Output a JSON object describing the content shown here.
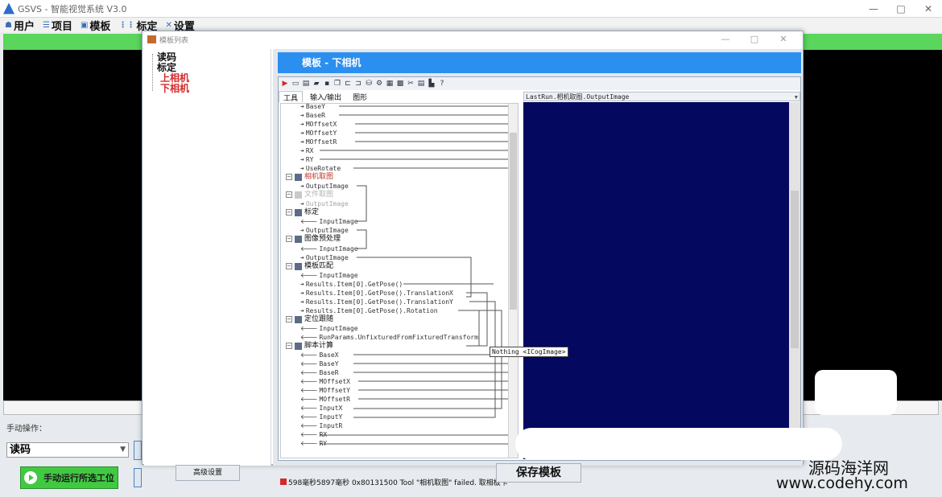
{
  "app": {
    "title": "GSVS - 智能视觉系统 V3.0",
    "window_buttons": [
      "—",
      "□",
      "✕"
    ]
  },
  "main_menu": [
    {
      "label": "用户",
      "icon": "user-icon"
    },
    {
      "label": "项目",
      "icon": "project-icon"
    },
    {
      "label": "模板",
      "icon": "template-icon"
    },
    {
      "label": "标定",
      "icon": "calibrate-icon"
    },
    {
      "label": "设置",
      "icon": "settings-icon"
    }
  ],
  "dialog": {
    "title": "模板列表",
    "window_buttons": [
      "—",
      "□",
      "✕"
    ],
    "header": "模板 - 下相机",
    "tree": [
      "读码",
      "标定",
      "上相机",
      "下相机"
    ],
    "tabs": [
      "工具",
      "输入/输出",
      "图形"
    ],
    "image_source": "LastRun.相机取图.OutputImage",
    "tooltip": "Nothing <ICogImage>",
    "status": "598毫秒5897毫秒 0x80131500  Tool \"相机取图\" failed. 取相板卡",
    "buttons": {
      "advanced": "高级设置",
      "save": "保存模板"
    }
  },
  "graph": {
    "top_outputs": [
      "BaseY",
      "BaseR",
      "MOffsetX",
      "MOffsetY",
      "MOffsetR",
      "RX",
      "RY",
      "UseRotate"
    ],
    "tool_camera": "相机取图",
    "out_camera": "OutputImage",
    "tool_file": "文件取图",
    "out_file": "OutputImage",
    "tool_calib": "标定",
    "calib_in": "InputImage",
    "calib_out": "OutputImage",
    "tool_pre": "图像预处理",
    "pre_in": "InputImage",
    "pre_out": "OutputImage",
    "tool_match": "模板匹配",
    "match_in": "InputImage",
    "match_outs": [
      "Results.Item[0].GetPose()",
      "Results.Item[0].GetPose().TranslationX",
      "Results.Item[0].GetPose().TranslationY",
      "Results.Item[0].GetPose().Rotation"
    ],
    "tool_fixture": "定位跟随",
    "fixture_in": "InputImage",
    "fixture_param": "RunParams.UnfixturedFromFixturedTransform",
    "tool_script": "脚本计算",
    "script_ins": [
      "BaseX",
      "BaseY",
      "BaseR",
      "MOffsetX",
      "MOffsetY",
      "MOffsetR",
      "InputX",
      "InputY",
      "InputR",
      "RX",
      "RY"
    ]
  },
  "bottom": {
    "label": "手动操作：",
    "select_value": "读码",
    "run_button": "手动运行所选工位"
  },
  "watermark": {
    "line1": "源码海洋网",
    "line2": "www.codehy.com"
  }
}
